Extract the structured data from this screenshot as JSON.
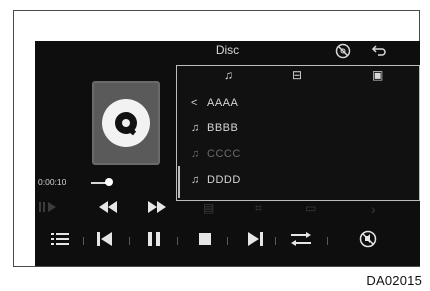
{
  "header": {
    "title": "Disc",
    "disc_off_icon": "no-disc-icon",
    "back_icon": "back-arrow-icon"
  },
  "album_art": {
    "icon": "disc-icon"
  },
  "panel": {
    "tabs": [
      {
        "name": "music-note-tab-icon",
        "glyph": "♫"
      },
      {
        "name": "folder-tab-icon",
        "glyph": "⊟"
      },
      {
        "name": "image-tab-icon",
        "glyph": "▣"
      }
    ],
    "items": [
      {
        "icon": "<",
        "label": "AAAA",
        "state": "normal"
      },
      {
        "icon": "♫",
        "label": "BBBB",
        "state": "normal"
      },
      {
        "icon": "♫",
        "label": "CCCC",
        "state": "dimmed"
      },
      {
        "icon": "♫",
        "label": "DDDD",
        "state": "normal"
      }
    ]
  },
  "playback": {
    "elapsed": "0:00:10",
    "progress_fraction": 0.05
  },
  "controls_row1": [
    {
      "name": "play-dim-icon",
      "glyph": "▶",
      "enabled": false
    },
    {
      "name": "rewind-icon",
      "glyph": "◀◀",
      "enabled": true
    },
    {
      "name": "fast-forward-icon",
      "glyph": "▶▶",
      "enabled": true
    },
    {
      "name": "radio-icon",
      "glyph": "▤",
      "enabled": false
    },
    {
      "name": "scan-icon",
      "glyph": "⌗",
      "enabled": false
    },
    {
      "name": "folder-icon",
      "glyph": "▭",
      "enabled": false
    },
    {
      "name": "next-page-icon",
      "glyph": "›",
      "enabled": false
    }
  ],
  "controls_row2": [
    {
      "name": "list-icon",
      "glyph": "☰"
    },
    {
      "name": "previous-track-icon",
      "glyph": "⏮"
    },
    {
      "name": "pause-icon",
      "glyph": "❚❚"
    },
    {
      "name": "stop-icon",
      "glyph": "■"
    },
    {
      "name": "next-track-icon",
      "glyph": "⏭"
    },
    {
      "name": "shuffle-repeat-icon",
      "glyph": "⇆"
    },
    {
      "name": "mute-icon",
      "glyph": "⊘"
    }
  ],
  "figure_code": "DA02015"
}
